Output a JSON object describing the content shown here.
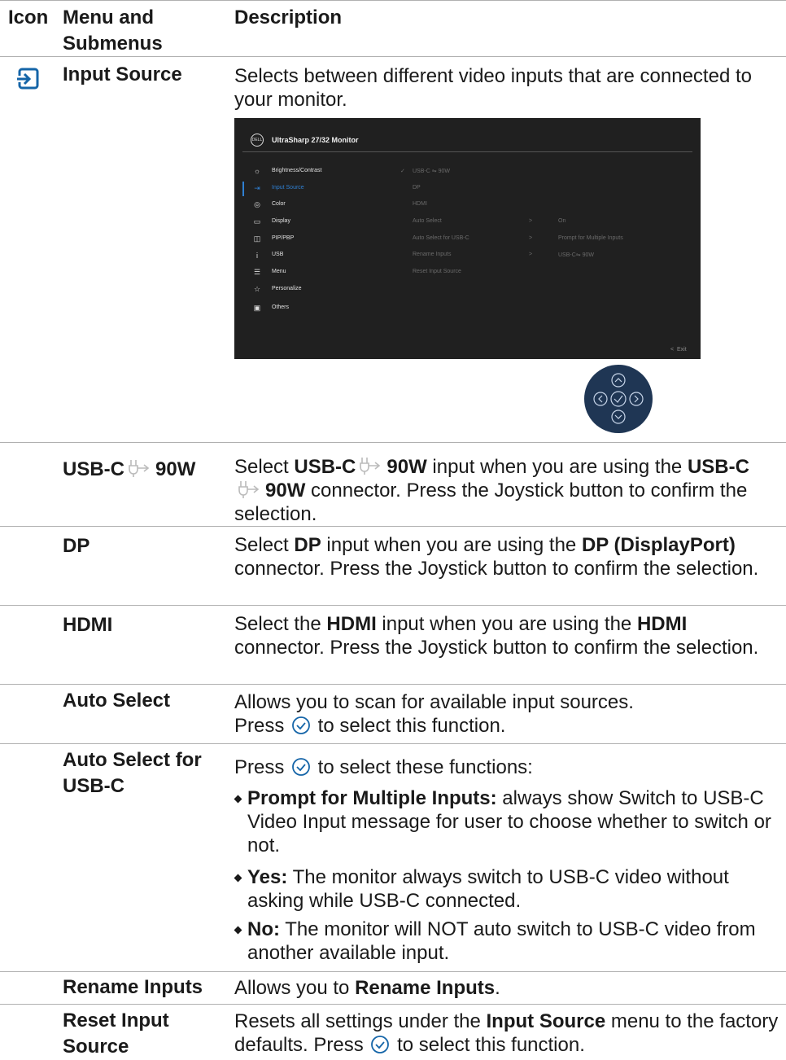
{
  "headers": {
    "icon": "Icon",
    "menu": "Menu and Submenus",
    "description": "Description"
  },
  "rows": {
    "input_source": {
      "icon": "input-source-icon",
      "menu": "Input Source",
      "description": "Selects between different video inputs that are connected to your monitor."
    },
    "usbc": {
      "menu_a": "USB-C",
      "menu_b": "90W",
      "d1": "Select ",
      "d2": "USB-C",
      "d3": "90W",
      "d4": " input when you are using the ",
      "d5": "USB-C",
      "d6": "90W",
      "d7": " connector. Press the Joystick button to confirm the selection."
    },
    "dp": {
      "menu": "DP",
      "d1": "Select ",
      "d2": "DP",
      "d3": " input when you are using the ",
      "d4": "DP (DisplayPort)",
      "d5": " connector. Press the Joystick button to confirm the selection."
    },
    "hdmi": {
      "menu": "HDMI",
      "d1": "Select the ",
      "d2": "HDMI",
      "d3": " input when you are using the ",
      "d4": "HDMI",
      "d5": " connector. Press the Joystick button to confirm the selection."
    },
    "auto_select": {
      "menu": "Auto Select",
      "line1": "Allows you to scan for available input sources.",
      "line2a": "Press ",
      "line2b": " to select this function."
    },
    "auto_usbc": {
      "menu": "Auto Select for USB-C",
      "intro_a": "Press ",
      "intro_b": " to select these functions:",
      "b1_bold": "Prompt for Multiple Inputs:",
      "b1_text": " always show Switch to USB-C Video Input message for user to choose whether to switch or not.",
      "b2_bold": "Yes:",
      "b2_text": " The monitor always switch to USB-C video without asking while USB-C connected.",
      "b3_bold": "No:",
      "b3_text": " The monitor will NOT auto switch to USB-C video from another available input."
    },
    "rename": {
      "menu": "Rename Inputs",
      "d1": "Allows you to ",
      "d2": "Rename Inputs",
      "d3": "."
    },
    "reset": {
      "menu": "Reset Input Source",
      "d1": "Resets all settings under the ",
      "d2": "Input Source",
      "d3": " menu to the factory defaults. Press ",
      "d4": " to select this function."
    }
  },
  "osd": {
    "logo": "DELL",
    "title": "UltraSharp 27/32 Monitor",
    "menu": [
      "Brightness/Contrast",
      "Input Source",
      "Color",
      "Display",
      "PIP/PBP",
      "USB",
      "Menu",
      "Personalize",
      "Others"
    ],
    "menu_icons": [
      "brightness-icon",
      "input-source-icon",
      "color-icon",
      "display-icon",
      "pip-pbp-icon",
      "usb-icon",
      "menu-icon",
      "personalize-icon",
      "others-icon"
    ],
    "active_index": 1,
    "submenu": [
      "USB-C",
      "DP",
      "HDMI",
      "Auto Select",
      "Auto Select for USB-C",
      "Rename Inputs",
      "Reset Input Source"
    ],
    "usbc_power": "90W",
    "values": {
      "auto_select": "On",
      "auto_usbc": "Prompt for Multiple Inputs",
      "rename_a": "USB-C",
      "rename_b": "90W"
    },
    "arrow": ">",
    "check": "✓",
    "exit": "Exit",
    "exit_arrow": "<"
  },
  "colors": {
    "accent": "#2f7fd1",
    "osd_bg": "#202020",
    "joystick_bg": "#1f3654",
    "icon_blue": "#1565a8"
  }
}
